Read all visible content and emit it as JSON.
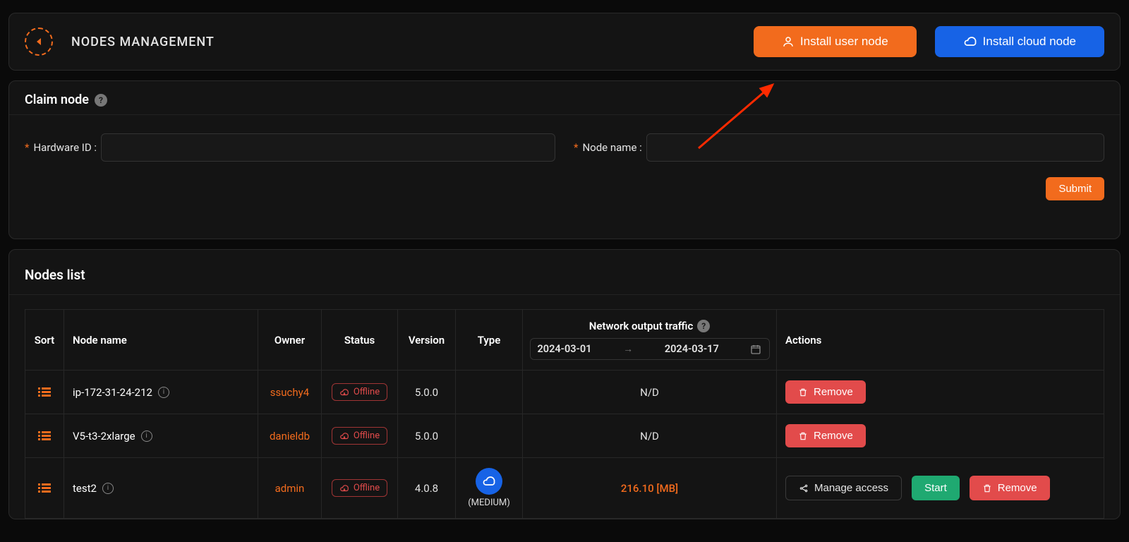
{
  "header": {
    "title": "NODES MANAGEMENT",
    "install_user": "Install user node",
    "install_cloud": "Install cloud node"
  },
  "claim": {
    "title": "Claim node",
    "hardware_id_label": "Hardware ID :",
    "node_name_label": "Node name :",
    "submit": "Submit"
  },
  "list": {
    "title": "Nodes list",
    "columns": {
      "sort": "Sort",
      "node_name": "Node name",
      "owner": "Owner",
      "status": "Status",
      "version": "Version",
      "type": "Type",
      "network": "Network output traffic",
      "actions": "Actions"
    },
    "date_from": "2024-03-01",
    "date_to": "2024-03-17",
    "status_label": "Offline",
    "remove": "Remove",
    "start": "Start",
    "manage_access": "Manage access",
    "rows": [
      {
        "name": "ip-172-31-24-212",
        "owner": "ssuchy4",
        "version": "5.0.0",
        "type": "",
        "type_size": "",
        "traffic": "N/D",
        "actions": "remove"
      },
      {
        "name": "V5-t3-2xlarge",
        "owner": "danieldb",
        "version": "5.0.0",
        "type": "",
        "type_size": "",
        "traffic": "N/D",
        "actions": "remove"
      },
      {
        "name": "test2",
        "owner": "admin",
        "version": "4.0.8",
        "type": "cloud",
        "type_size": "(MEDIUM)",
        "traffic": "216.10 [MB]",
        "actions": "full"
      }
    ]
  }
}
